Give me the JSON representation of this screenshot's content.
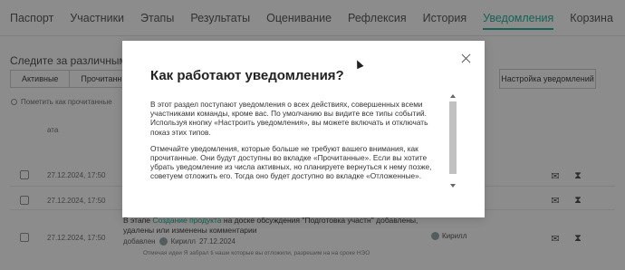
{
  "tabs": [
    {
      "label": "Паспорт"
    },
    {
      "label": "Участники"
    },
    {
      "label": "Этапы"
    },
    {
      "label": "Результаты"
    },
    {
      "label": "Оценивание"
    },
    {
      "label": "Рефлексия"
    },
    {
      "label": "История"
    },
    {
      "label": "Уведомления",
      "active": true
    },
    {
      "label": "Корзина"
    }
  ],
  "page": {
    "subtitle": "Следите за различными изм",
    "filters": [
      "Активные",
      "Прочитанные"
    ],
    "settings_label": "Настройка уведомлений",
    "mark_read_label": "Пометить как прочитанные",
    "col_date": "ата"
  },
  "rows": [
    {
      "date": "27.12.2024, 17:50"
    },
    {
      "date": "27.12.2024, 17:50"
    },
    {
      "date": "27.12.2024, 17:50",
      "text_prefix": "В этапе ",
      "text_link": "Создание продукта",
      "text_suffix": " на доске обсуждения \"Подготовка участн\" добавлены, удалены или изменены комментарии",
      "added_label": "добавлен",
      "author": "Кирилл",
      "added_date": "27.12.2024",
      "note": "Отмечая идеи Я забрал ti наши которые вы отложили, разрешим на на сроке НЭО",
      "user": "Кирилл"
    }
  ],
  "modal": {
    "title": "Как работают уведомления?",
    "paragraphs": [
      "В этот раздел поступают уведомления о всех действиях, совершенных всеми участниками команды, кроме вас. По умолчанию вы видите все типы событий. Используя кнопку «Настроить уведомления», вы можете включать и отключать показ этих типов.",
      "Отмечайте уведомления, которые больше не требуют вашего внимания, как прочитанные. Они будут доступны во вкладке «Прочитанные». Если вы хотите убрать уведомление из числа активных, но планируете вернуться к нему позже, советуем отложить его. Тогда оно будет доступно во вкладке «Отложенные»."
    ]
  },
  "colors": {
    "accent": "#2bb39a",
    "overlay": "rgba(0,0,0,0.45)"
  }
}
